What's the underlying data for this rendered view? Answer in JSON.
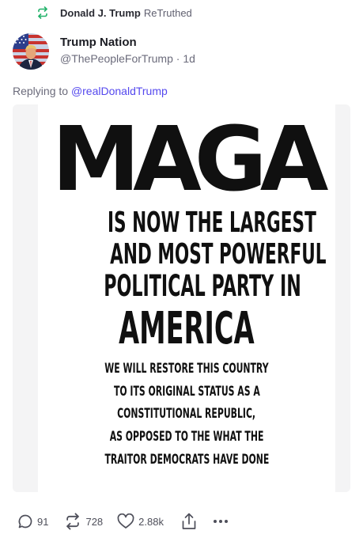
{
  "retruth": {
    "icon": "retruth-icon",
    "user": "Donald J. Trump",
    "label": "ReTruthed",
    "accent": "#22b26a"
  },
  "post": {
    "author_name": "Trump Nation",
    "author_handle": "@ThePeopleForTrump",
    "separator": "·",
    "age": "1d",
    "reply_prefix": "Replying to",
    "reply_to": "@realDonaldTrump",
    "link_color": "#5448ee"
  },
  "image_text": {
    "headline": "MAGA",
    "line1": "IS NOW THE LARGEST",
    "line2": "AND MOST POWERFUL",
    "line3": "POLITICAL PARTY IN",
    "line4": "AMERICA",
    "sub1": "WE WILL RESTORE THIS COUNTRY",
    "sub2": "TO ITS ORIGINAL STATUS AS A",
    "sub3": "CONSTITUTIONAL REPUBLIC,",
    "sub4": "AS OPPOSED TO THE WHAT THE",
    "sub5": "TRAITOR DEMOCRATS HAVE DONE"
  },
  "actions": {
    "replies": {
      "icon": "reply-icon",
      "count": "91"
    },
    "retruths": {
      "icon": "retruth-icon",
      "count": "728"
    },
    "likes": {
      "icon": "heart-icon",
      "count": "2.88k"
    },
    "share": {
      "icon": "share-icon"
    },
    "more": {
      "icon": "more-icon"
    }
  }
}
